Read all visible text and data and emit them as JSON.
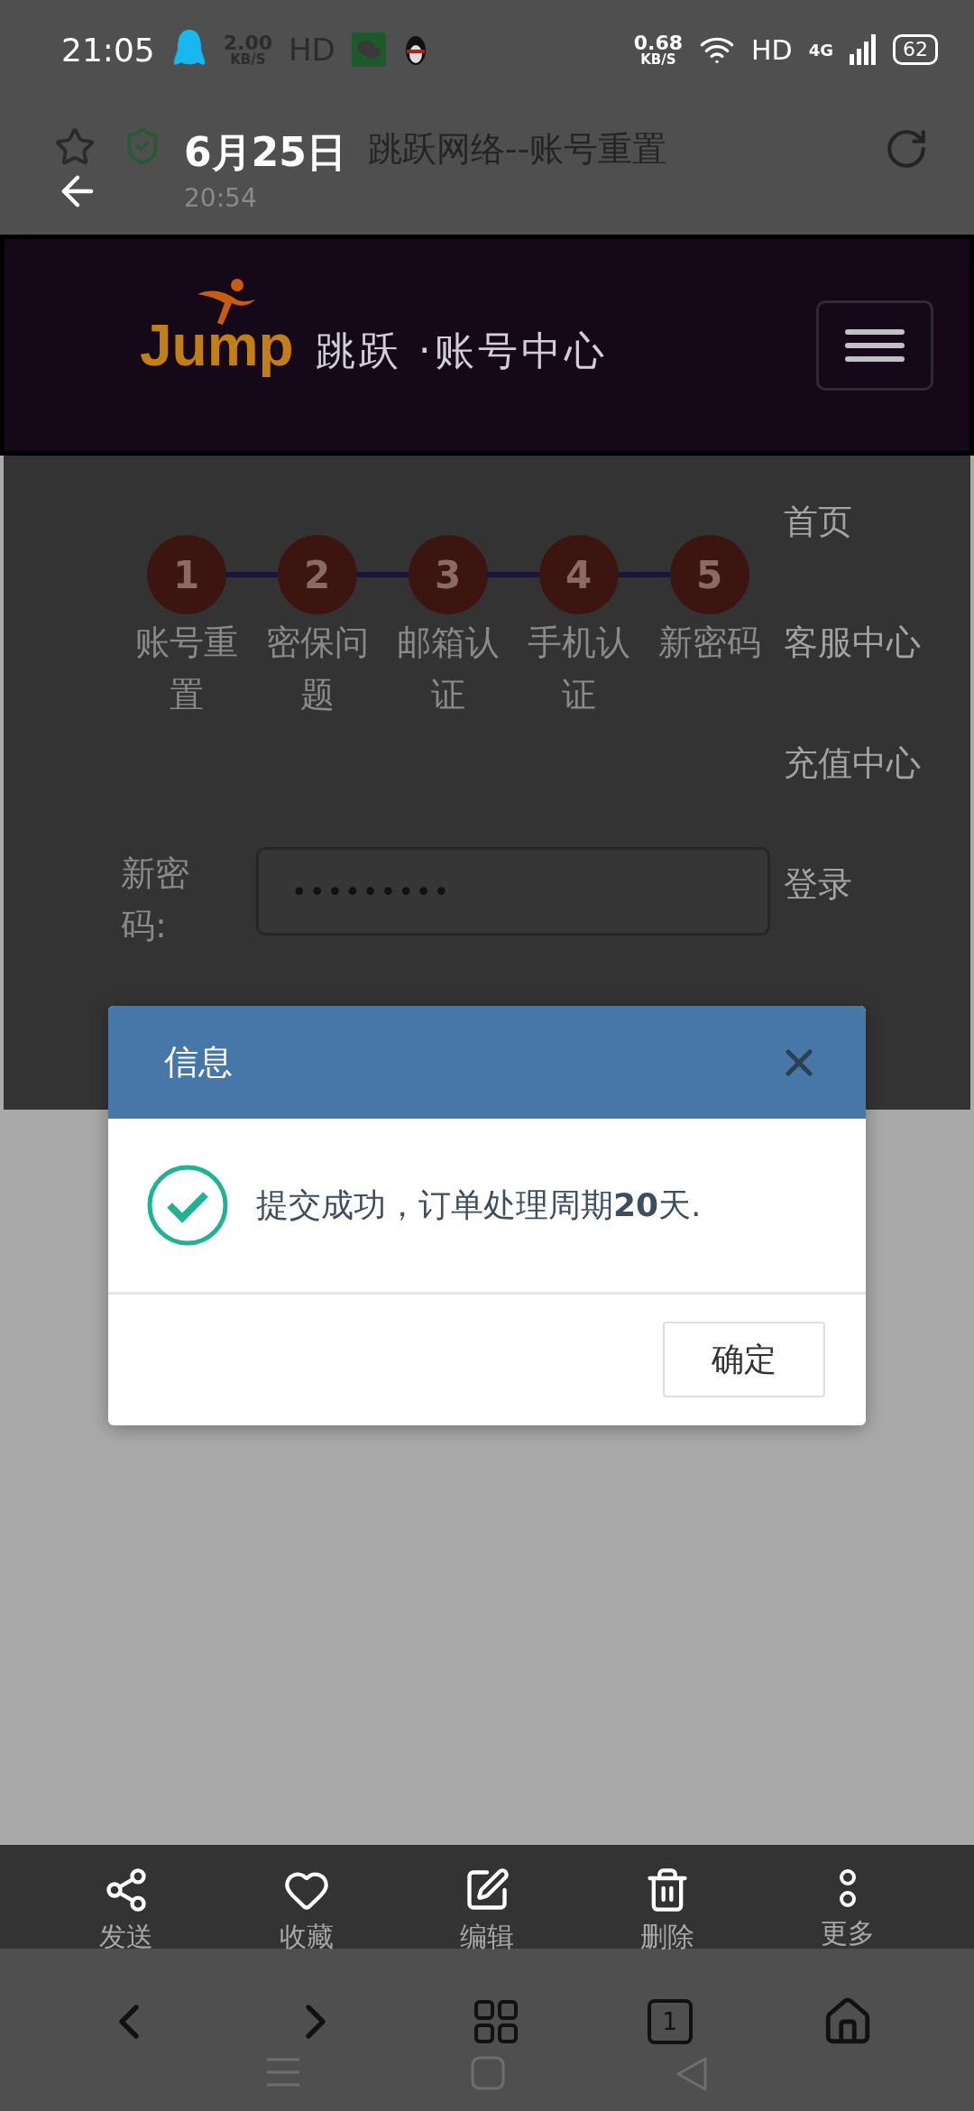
{
  "status_bar": {
    "time": "21:05",
    "under_speed": "2.00",
    "under_unit": "KB/S",
    "under_hd": "HD",
    "speed": "0.68",
    "speed_unit": "KB/S",
    "hd": "HD",
    "network": "4G",
    "battery": "62"
  },
  "viewer": {
    "date": "6月25日",
    "time": "20:54"
  },
  "browser": {
    "title": "跳跃网络--账号重置"
  },
  "site": {
    "logo_text": "Jump",
    "brand": "跳跃 ·账号中心"
  },
  "steps": [
    {
      "number": "1",
      "label": "账号重置"
    },
    {
      "number": "2",
      "label": "密保问题"
    },
    {
      "number": "3",
      "label": "邮箱认证"
    },
    {
      "number": "4",
      "label": "手机认证"
    },
    {
      "number": "5",
      "label": "新密码"
    }
  ],
  "form": {
    "label": "新密码:",
    "value": "•••••••••"
  },
  "menu": [
    "首页",
    "客服中心",
    "充值中心",
    "登录"
  ],
  "dialog": {
    "title": "信息",
    "message": "提交成功，订单处理周期**20**天.",
    "button": "确定"
  },
  "toolbar": [
    {
      "kind": "share",
      "label": "发送"
    },
    {
      "kind": "favorite",
      "label": "收藏"
    },
    {
      "kind": "edit",
      "label": "编辑"
    },
    {
      "kind": "delete",
      "label": "删除"
    },
    {
      "kind": "more",
      "label": "更多"
    }
  ],
  "browser_nav": {
    "tab_count": "1"
  }
}
